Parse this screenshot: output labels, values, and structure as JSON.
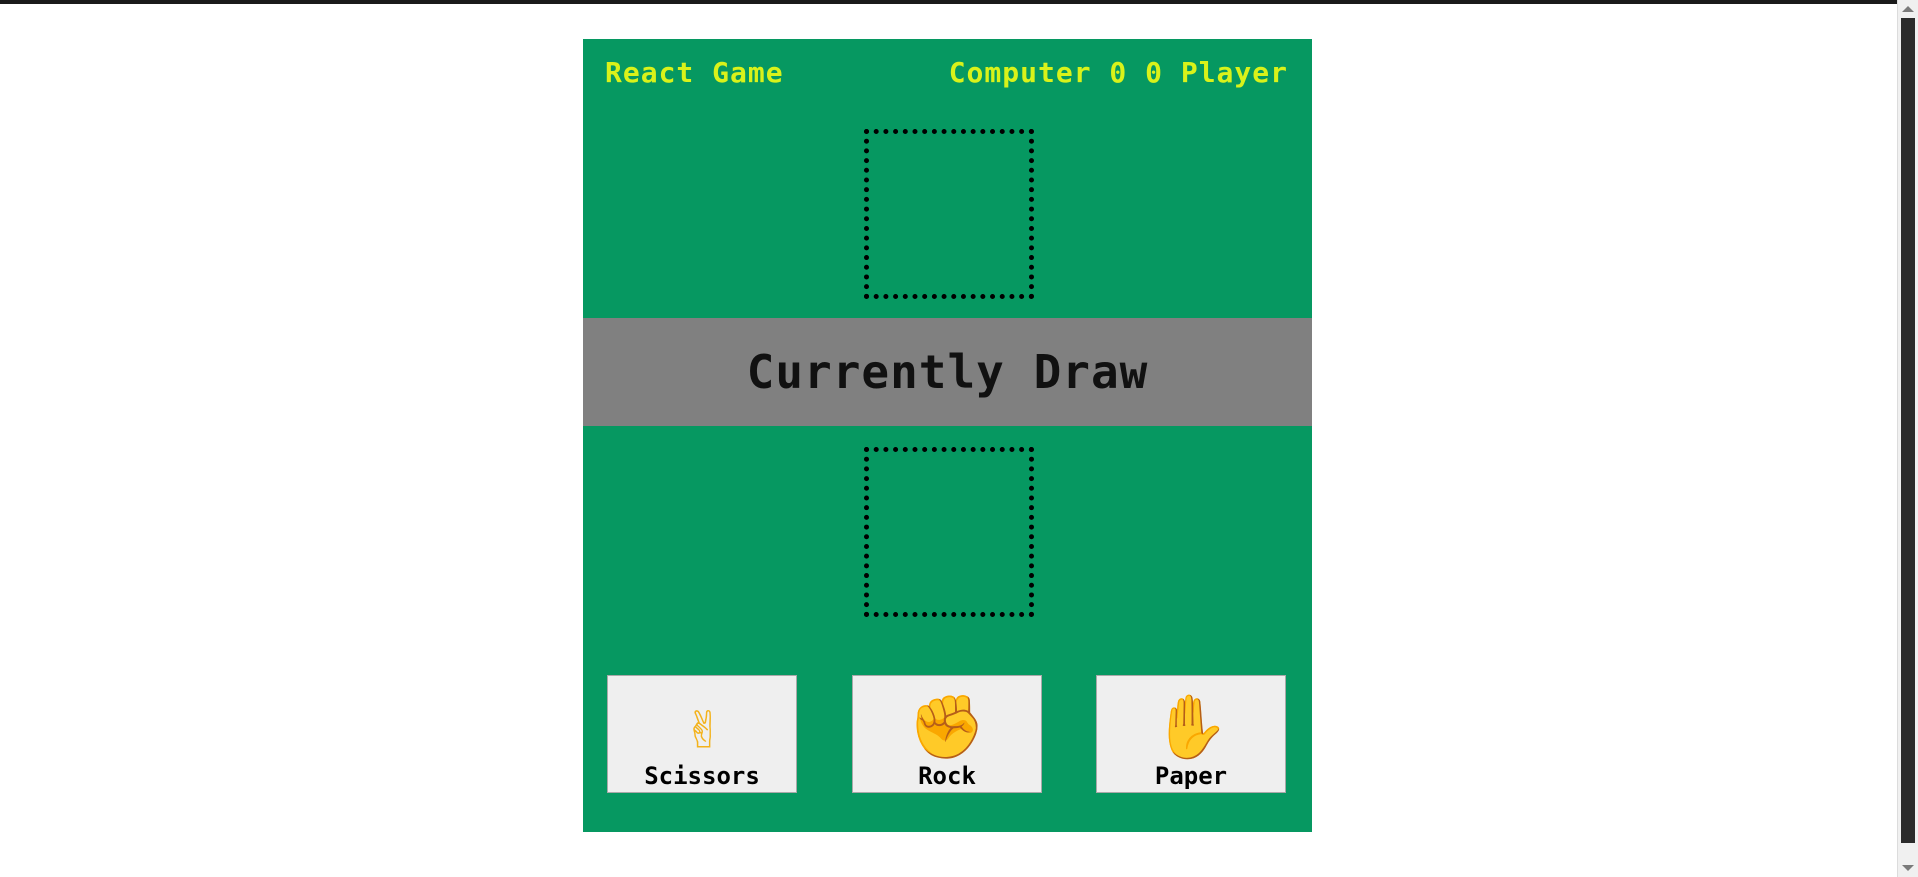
{
  "header": {
    "title": "React Game",
    "score_text": "Computer 0 0 Player",
    "computer_label": "Computer",
    "computer_score": "0",
    "player_score": "0",
    "player_label": "Player"
  },
  "status": {
    "text": "Currently Draw"
  },
  "choices": [
    {
      "label": "Scissors",
      "icon": "scissors-hand-icon",
      "glyph": "✌"
    },
    {
      "label": "Rock",
      "icon": "rock-fist-icon",
      "glyph": "✊"
    },
    {
      "label": "Paper",
      "icon": "paper-hand-icon",
      "glyph": "✋"
    }
  ],
  "colors": {
    "board": "#069861",
    "header_text": "#d9f21a",
    "status_bar": "#808080",
    "button_bg": "#efefef"
  }
}
